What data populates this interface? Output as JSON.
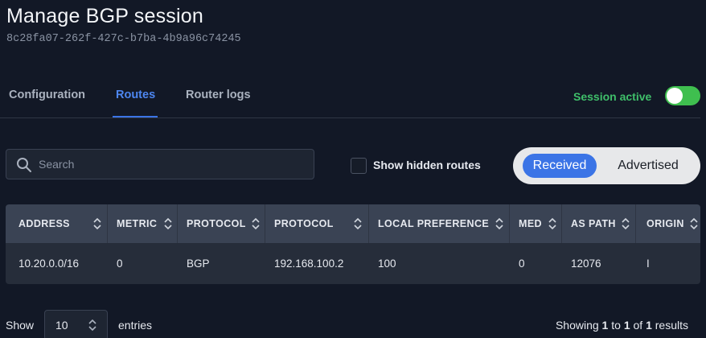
{
  "header": {
    "title": "Manage BGP session",
    "session_id": "8c28fa07-262f-427c-b7ba-4b9a96c74245"
  },
  "tabs": [
    {
      "label": "Configuration",
      "active": false
    },
    {
      "label": "Routes",
      "active": true
    },
    {
      "label": "Router logs",
      "active": false
    }
  ],
  "session": {
    "label": "Session active",
    "enabled": true,
    "color": "#3fbf6a"
  },
  "search": {
    "placeholder": "Search",
    "value": ""
  },
  "hidden_routes": {
    "label": "Show hidden routes",
    "checked": false
  },
  "direction": {
    "received_label": "Received",
    "advertised_label": "Advertised",
    "selected": "Received"
  },
  "table": {
    "columns": [
      "ADDRESS",
      "METRIC",
      "PROTOCOL",
      "PROTOCOL",
      "LOCAL PREFERENCE",
      "MED",
      "AS PATH",
      "ORIGIN"
    ],
    "rows": [
      [
        "10.20.0.0/16",
        "0",
        "BGP",
        "192.168.100.2",
        "100",
        "0",
        "12076",
        "I"
      ]
    ]
  },
  "pagination": {
    "show_label": "Show",
    "page_size": "10",
    "entries_label": "entries",
    "showing_prefix": "Showing",
    "from": "1",
    "to_label": "to",
    "to": "1",
    "of_label": "of",
    "total": "1",
    "results_label": "results"
  },
  "colors": {
    "accent": "#3b74e6",
    "background": "#121826",
    "toggle_on": "#3fbf4f"
  }
}
